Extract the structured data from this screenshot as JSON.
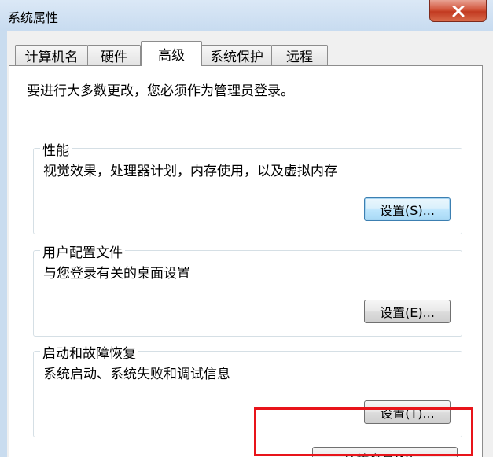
{
  "window": {
    "title": "系统属性"
  },
  "tabs": [
    {
      "label": "计算机名",
      "active": false
    },
    {
      "label": "硬件",
      "active": false
    },
    {
      "label": "高级",
      "active": true
    },
    {
      "label": "系统保护",
      "active": false
    },
    {
      "label": "远程",
      "active": false
    }
  ],
  "advanced": {
    "note": "要进行大多数更改，您必须作为管理员登录。",
    "performance": {
      "title": "性能",
      "description": "视觉效果，处理器计划，内存使用，以及虚拟内存",
      "button": "设置(S)..."
    },
    "user_profiles": {
      "title": "用户配置文件",
      "description": "与您登录有关的桌面设置",
      "button": "设置(E)..."
    },
    "startup_recovery": {
      "title": "启动和故障恢复",
      "description": "系统启动、系统失败和调试信息",
      "button": "设置(T)..."
    },
    "env_button": "环境变量(N)..."
  },
  "colors": {
    "highlight": "#e8141a",
    "focus_border": "#3c7fb1",
    "titlebar": "#c7dbf0"
  }
}
